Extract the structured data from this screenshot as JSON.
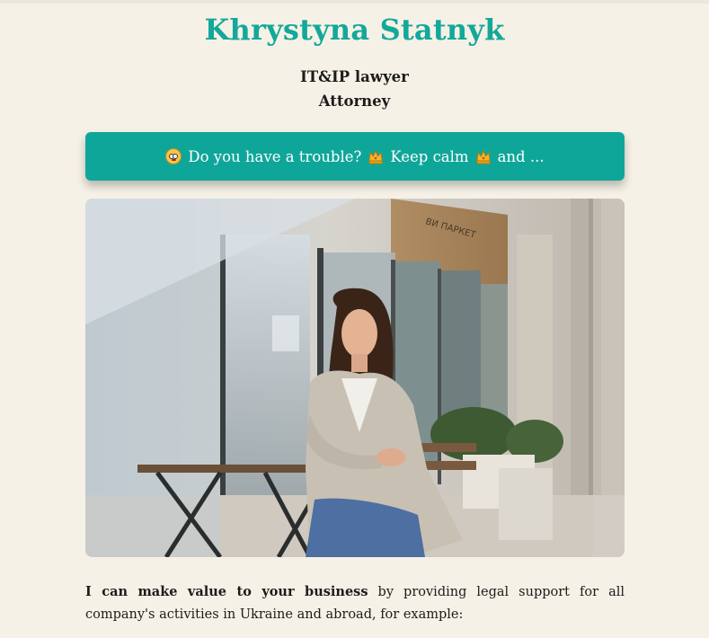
{
  "header": {
    "name": "Khrystyna Statnyk",
    "role_line1": "IT&IP lawyer",
    "role_line2": "Attorney"
  },
  "cta": {
    "part1": "Do you have a trouble?",
    "part2": "Keep calm",
    "part3": "and ...",
    "icons": [
      "flushed-face-icon",
      "crown-icon",
      "crown-icon"
    ]
  },
  "hero_photo": {
    "sign_text": "ВИ ПАРКЕТ"
  },
  "intro": {
    "bold": "I can make value to your business",
    "rest": "by providing legal support for all company's activities in Ukraine and abroad, for example:"
  },
  "colors": {
    "background": "#f6f1e6",
    "accent": "#13a89a",
    "button": "#0fa69a"
  }
}
